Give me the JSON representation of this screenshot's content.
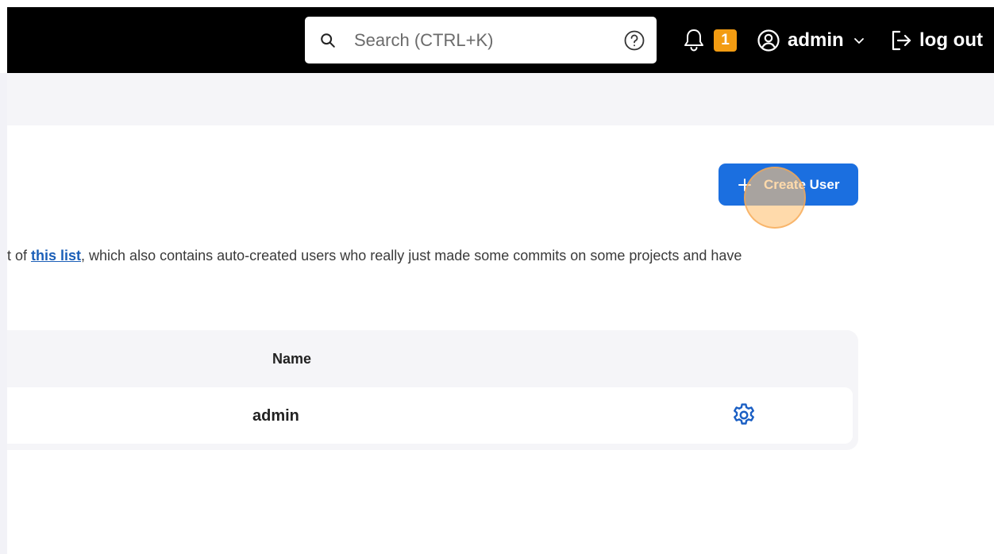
{
  "header": {
    "search": {
      "placeholder": "Search (CTRL+K)",
      "search_icon": "search-icon",
      "help_icon": "help-circle-icon"
    },
    "notifications": {
      "icon": "bell-icon",
      "count": "1",
      "badge_color": "#f39c12"
    },
    "user_menu": {
      "icon": "user-circle-icon",
      "label": "admin",
      "chevron_icon": "chevron-down-icon"
    },
    "logout": {
      "icon": "logout-icon",
      "label": "log out"
    }
  },
  "actions": {
    "create_user_label": "Create User",
    "create_user_icon": "plus-icon",
    "accent_color": "#1b6fe0"
  },
  "description": {
    "prefix": "t of ",
    "link_text": "this list",
    "suffix": ", which also contains auto-created users who really just made some commits on some projects and have"
  },
  "table": {
    "columns": [
      "Name"
    ],
    "rows": [
      {
        "name": "admin",
        "action_icon": "gear-icon"
      }
    ]
  }
}
